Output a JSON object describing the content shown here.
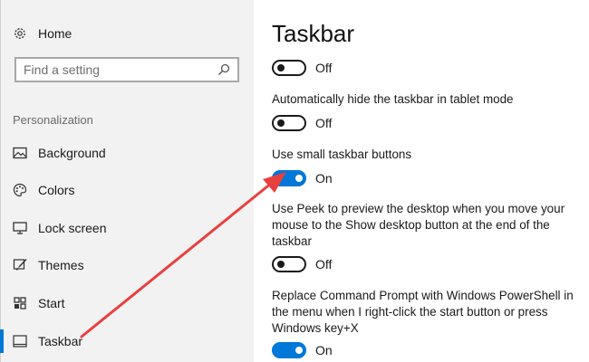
{
  "sidebar": {
    "home_label": "Home",
    "search_placeholder": "Find a setting",
    "section_label": "Personalization",
    "items": [
      {
        "label": "Background"
      },
      {
        "label": "Colors"
      },
      {
        "label": "Lock screen"
      },
      {
        "label": "Themes"
      },
      {
        "label": "Start"
      },
      {
        "label": "Taskbar"
      }
    ]
  },
  "main": {
    "title": "Taskbar",
    "settings": [
      {
        "label": "",
        "state": "Off"
      },
      {
        "label": "Automatically hide the taskbar in tablet mode",
        "state": "Off"
      },
      {
        "label": "Use small taskbar buttons",
        "state": "On"
      },
      {
        "label": "Use Peek to preview the desktop when you move your mouse to the Show desktop button at the end of the taskbar",
        "state": "Off"
      },
      {
        "label": "Replace Command Prompt with Windows PowerShell in the menu when I right-click the start button or press Windows key+X",
        "state": "On"
      }
    ]
  },
  "colors": {
    "accent": "#0078d7",
    "arrow": "#e8403f",
    "sidebar_bg": "#f2f2f2"
  }
}
